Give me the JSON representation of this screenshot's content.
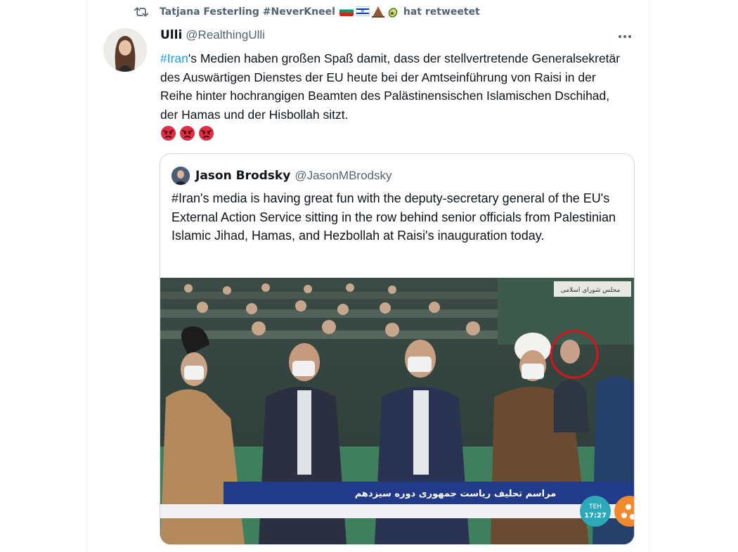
{
  "retweet": {
    "text": "Tatjana Festerling #NeverKneel",
    "suffix": "hat retweetet",
    "icon": "retweet-icon",
    "flag_emojis": [
      "bulgaria-flag",
      "israel-flag",
      "volcano",
      "avocado"
    ]
  },
  "tweet": {
    "author_name": "Ulli",
    "author_handle": "@RealthingUlli",
    "hashtag": "#Iran",
    "text": "'s Medien haben großen Spaß damit, dass der stellvertretende Generalsekretär des Auswärtigen Dienstes der EU heute bei der Amtseinführung von Raisi in der Reihe hinter hochrangigen Beamten des Palästinensischen Islamischen Dschihad, der Hamas und der Hisbollah sitzt.",
    "emojis": [
      "angry-face",
      "angry-face",
      "angry-face"
    ]
  },
  "quote": {
    "author_name": "Jason Brodsky",
    "author_handle": "@JasonMBrodsky",
    "text": "#Iran's media is having great fun with the deputy-secretary general of the EU's External Action Service sitting in the row behind senior officials from Palestinian Islamic Jihad, Hamas, and Hezbollah at Raisi's inauguration today.",
    "media": {
      "caption": "مراسم تحلیف ریاست جمهوری دوره سیزدهم",
      "corner_label": "مجلس شورای اسلامی",
      "clock_city": "TEH",
      "clock_time": "17:27",
      "highlight_color": "#d7141a"
    }
  }
}
